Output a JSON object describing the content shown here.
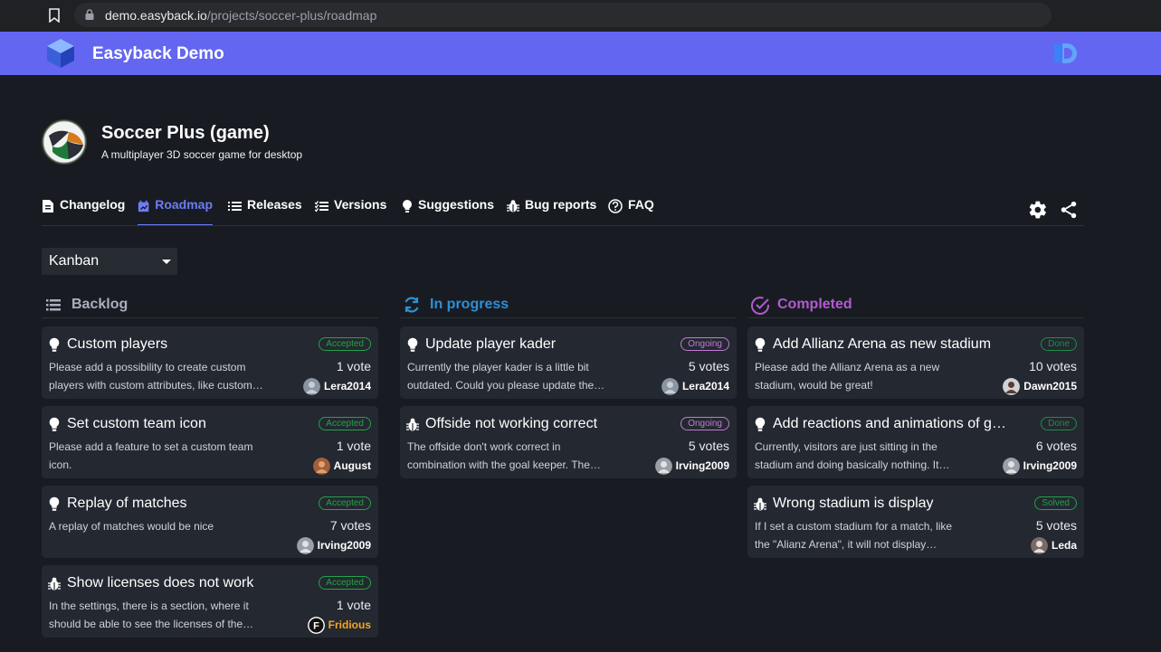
{
  "browser": {
    "url_host": "demo.easyback.io",
    "url_path": "/projects/soccer-plus/roadmap"
  },
  "app": {
    "title": "Easyback Demo"
  },
  "project": {
    "name": "Soccer Plus (game)",
    "description": "A multiplayer 3D soccer game for desktop"
  },
  "tabs": [
    {
      "label": "Changelog",
      "icon": "document-icon",
      "active": false
    },
    {
      "label": "Roadmap",
      "icon": "roadmap-icon",
      "active": true
    },
    {
      "label": "Releases",
      "icon": "list-icon",
      "active": false
    },
    {
      "label": "Versions",
      "icon": "checklist-icon",
      "active": false
    },
    {
      "label": "Suggestions",
      "icon": "lightbulb-icon",
      "active": false
    },
    {
      "label": "Bug reports",
      "icon": "bug-icon",
      "active": false
    },
    {
      "label": "FAQ",
      "icon": "help-icon",
      "active": false
    }
  ],
  "view": {
    "selected": "Kanban"
  },
  "colors": {
    "header": "#6366f1",
    "accent": "#6d7cf6",
    "backlog": "#aab0bb",
    "in_progress": "#2e8fd6",
    "completed": "#b25bd0",
    "accepted": "#22a34a",
    "ongoing": "#c27ad6"
  },
  "columns": [
    {
      "title": "Backlog",
      "icon": "list-icon",
      "cards": [
        {
          "title": "Custom players",
          "icon": "lightbulb-icon",
          "badge": "Accepted",
          "desc1": "Please add a possibility to create custom",
          "desc2": "players with custom attributes, like custom…",
          "votes": "1 vote",
          "user": "Lera2014"
        },
        {
          "title": "Set custom team icon",
          "icon": "lightbulb-icon",
          "badge": "Accepted",
          "desc1": "Please add a feature to set a custom team",
          "desc2": "icon.",
          "votes": "1 vote",
          "user": "August"
        },
        {
          "title": "Replay of matches",
          "icon": "lightbulb-icon",
          "badge": "Accepted",
          "desc1": "A replay of matches would be nice",
          "desc2": "",
          "votes": "7 votes",
          "user": "Irving2009"
        },
        {
          "title": "Show licenses does not work",
          "icon": "bug-icon",
          "badge": "Accepted",
          "desc1": "In the settings, there is a section, where it",
          "desc2": "should be able to see the licenses of the…",
          "votes": "1 vote",
          "user": "Fridious"
        }
      ]
    },
    {
      "title": "In progress",
      "icon": "sync-icon",
      "cards": [
        {
          "title": "Update player kader",
          "icon": "lightbulb-icon",
          "badge": "Ongoing",
          "desc1": "Currently the player kader is a little bit",
          "desc2": "outdated. Could you please update the…",
          "votes": "5 votes",
          "user": "Lera2014"
        },
        {
          "title": "Offside not working correct",
          "icon": "bug-icon",
          "badge": "Ongoing",
          "desc1": "The offside don't work correct in",
          "desc2": "combination with the goal keeper. The…",
          "votes": "5 votes",
          "user": "Irving2009"
        }
      ]
    },
    {
      "title": "Completed",
      "icon": "check-circle-icon",
      "cards": [
        {
          "title": "Add Allianz Arena as new stadium",
          "icon": "lightbulb-icon",
          "badge": "Done",
          "desc1": "Please add the Allianz Arena as a new",
          "desc2": "stadium, would be great!",
          "votes": "10 votes",
          "user": "Dawn2015"
        },
        {
          "title": "Add reactions and animations of game…",
          "icon": "lightbulb-icon",
          "badge": "Done",
          "desc1": "Currently, visitors are just sitting in the",
          "desc2": "stadium and doing basically nothing. It…",
          "votes": "6 votes",
          "user": "Irving2009"
        },
        {
          "title": "Wrong stadium is display",
          "icon": "bug-icon",
          "badge": "Solved",
          "desc1": "If I set a custom stadium for a match, like",
          "desc2": "the \"Alianz Arena\", it will not display…",
          "votes": "5 votes",
          "user": "Leda"
        }
      ]
    }
  ]
}
